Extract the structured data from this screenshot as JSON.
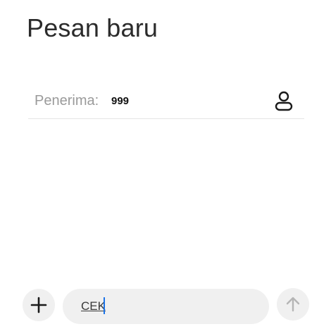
{
  "header": {
    "title": "Pesan baru"
  },
  "recipient": {
    "label": "Penerima:",
    "value": "999",
    "contact_icon": "person-icon"
  },
  "composer": {
    "attach_icon": "plus-icon",
    "message_text": "CEK",
    "send_icon": "arrow-up-icon"
  },
  "colors": {
    "background": "#ffffff",
    "field_background": "#f0f0f0",
    "caret": "#1b73e8",
    "label_gray": "#9a9a9a",
    "divider": "#e4e4e4"
  }
}
